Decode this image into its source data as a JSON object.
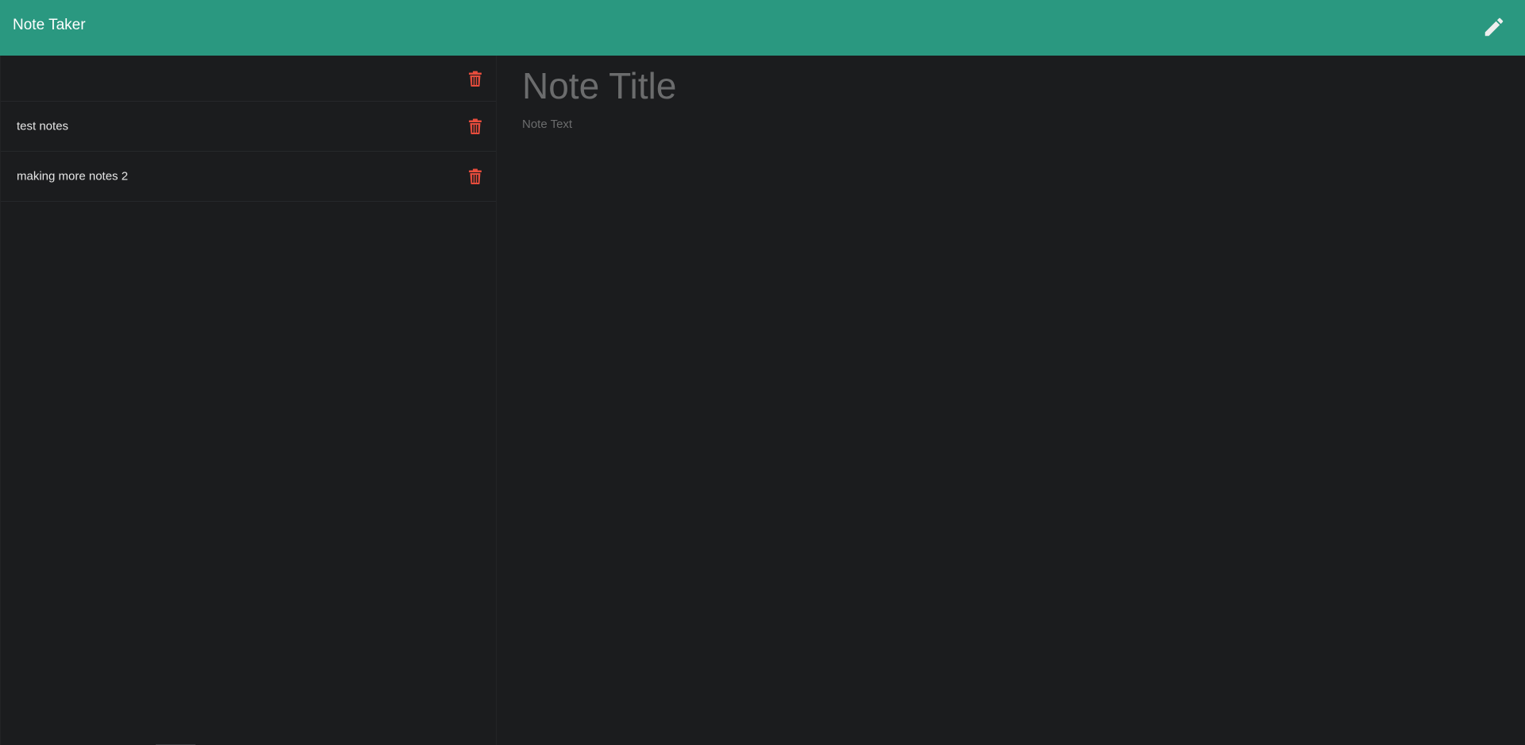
{
  "app": {
    "title": "Note Taker"
  },
  "navbar": {
    "new_note_icon": "pencil-icon",
    "background": "#2a9880"
  },
  "sidebar": {
    "items": [
      {
        "label": ""
      },
      {
        "label": "test notes"
      },
      {
        "label": "making more notes 2"
      }
    ],
    "delete_icon": "trash-icon",
    "delete_color": "#e74c3c"
  },
  "editor": {
    "title_placeholder": "Note Title",
    "title_value": "",
    "text_placeholder": "Note Text",
    "text_value": ""
  }
}
